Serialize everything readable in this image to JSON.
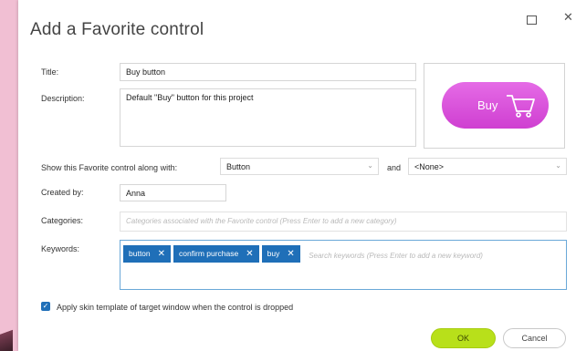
{
  "dialog": {
    "title": "Add a Favorite control",
    "window_controls": {
      "maximize_icon": "maximize-icon",
      "close_icon": "close-icon"
    }
  },
  "form": {
    "title_label": "Title:",
    "title_value": "Buy button",
    "description_label": "Description:",
    "description_value": "Default \"Buy\" button for this project",
    "show_along_label": "Show this Favorite control along with:",
    "show_along_value": "Button",
    "and_label": "and",
    "and_value": "<None>",
    "created_by_label": "Created by:",
    "created_by_value": "Anna",
    "categories_label": "Categories:",
    "categories_placeholder": "Categories associated with the Favorite control (Press Enter to add a new category)",
    "keywords_label": "Keywords:",
    "keywords": [
      "button",
      "confirm purchase",
      "buy"
    ],
    "keywords_placeholder": "Search keywords (Press Enter to add a new keyword)",
    "apply_skin_label": "Apply skin template of target window when the control is dropped",
    "apply_skin_checked": true
  },
  "preview": {
    "button_label": "Buy",
    "icon": "shopping-cart-icon",
    "color": "#d446d6"
  },
  "footer": {
    "ok_label": "OK",
    "cancel_label": "Cancel",
    "ok_color": "#b8e01a"
  }
}
